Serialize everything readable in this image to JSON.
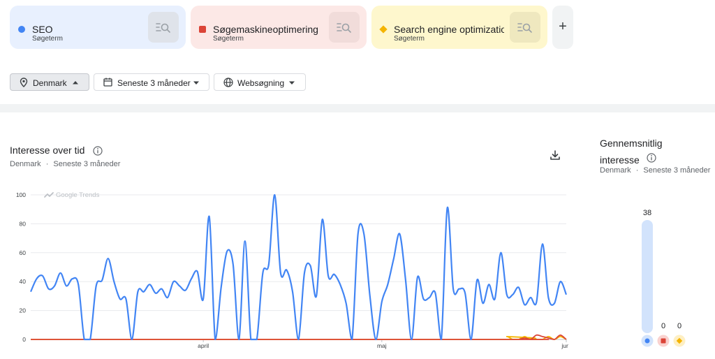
{
  "terms": [
    {
      "name": "SEO",
      "type": "Søgeterm",
      "color": "#4285f4"
    },
    {
      "name": "Søgemaskineoptimering",
      "type": "Søgeterm",
      "color": "#db4437"
    },
    {
      "name": "Search engine optimization",
      "type": "Søgeterm",
      "color": "#f4b400"
    }
  ],
  "add_label": "+",
  "filters": {
    "region": "Denmark",
    "period": "Seneste 3 måneder",
    "search_type": "Websøgning"
  },
  "interest_over_time": {
    "title": "Interesse over tid",
    "subtitle_region": "Denmark",
    "subtitle_sep": "·",
    "subtitle_period": "Seneste 3 måneder",
    "watermark": "Google Trends"
  },
  "average_interest": {
    "title_line1": "Gennemsnitlig",
    "title_line2": "interesse",
    "subtitle_region": "Denmark",
    "subtitle_sep": "·",
    "subtitle_period": "Seneste 3 måneder"
  },
  "chart_data": [
    {
      "type": "line",
      "title": "Interesse over tid",
      "y_ticks": [
        0,
        20,
        40,
        60,
        80,
        100
      ],
      "ylim": [
        0,
        100
      ],
      "x_tick_labels": [
        "april",
        "maj",
        "juni"
      ],
      "x_range": [
        "2024-03-03",
        "2024-06-01"
      ],
      "grid": true,
      "series": [
        {
          "name": "SEO",
          "color": "#4285f4",
          "x": [
            "2024-03-03",
            "2024-03-04",
            "2024-03-05",
            "2024-03-06",
            "2024-03-07",
            "2024-03-08",
            "2024-03-09",
            "2024-03-10",
            "2024-03-11",
            "2024-03-12",
            "2024-03-13",
            "2024-03-14",
            "2024-03-15",
            "2024-03-16",
            "2024-03-17",
            "2024-03-18",
            "2024-03-19",
            "2024-03-20",
            "2024-03-21",
            "2024-03-22",
            "2024-03-23",
            "2024-03-24",
            "2024-03-25",
            "2024-03-26",
            "2024-03-27",
            "2024-03-28",
            "2024-03-29",
            "2024-03-30",
            "2024-03-31",
            "2024-04-01",
            "2024-04-02",
            "2024-04-03",
            "2024-04-04",
            "2024-04-05",
            "2024-04-06",
            "2024-04-07",
            "2024-04-08",
            "2024-04-09",
            "2024-04-10",
            "2024-04-11",
            "2024-04-12",
            "2024-04-13",
            "2024-04-14",
            "2024-04-15",
            "2024-04-16",
            "2024-04-17",
            "2024-04-18",
            "2024-04-19",
            "2024-04-20",
            "2024-04-21",
            "2024-04-22",
            "2024-04-23",
            "2024-04-24",
            "2024-04-25",
            "2024-04-26",
            "2024-04-27",
            "2024-04-28",
            "2024-04-29",
            "2024-04-30",
            "2024-05-01",
            "2024-05-02",
            "2024-05-03",
            "2024-05-04",
            "2024-05-05",
            "2024-05-06",
            "2024-05-07",
            "2024-05-08",
            "2024-05-09",
            "2024-05-10",
            "2024-05-11",
            "2024-05-12",
            "2024-05-13",
            "2024-05-14",
            "2024-05-15",
            "2024-05-16",
            "2024-05-17",
            "2024-05-18",
            "2024-05-19",
            "2024-05-20",
            "2024-05-21",
            "2024-05-22",
            "2024-05-23",
            "2024-05-24",
            "2024-05-25",
            "2024-05-26",
            "2024-05-27",
            "2024-05-28",
            "2024-05-29",
            "2024-05-30",
            "2024-05-31",
            "2024-06-01"
          ],
          "values": [
            33,
            42,
            44,
            35,
            37,
            46,
            37,
            42,
            38,
            0,
            0,
            37,
            41,
            56,
            40,
            28,
            28,
            0,
            33,
            33,
            38,
            32,
            35,
            29,
            40,
            37,
            34,
            42,
            47,
            28,
            85,
            0,
            36,
            61,
            52,
            0,
            68,
            0,
            0,
            46,
            52,
            100,
            46,
            48,
            33,
            0,
            46,
            51,
            30,
            83,
            44,
            45,
            38,
            25,
            0,
            73,
            73,
            30,
            0,
            26,
            38,
            56,
            73,
            41,
            0,
            43,
            28,
            29,
            32,
            0,
            91,
            35,
            35,
            32,
            0,
            41,
            25,
            38,
            28,
            60,
            31,
            31,
            36,
            24,
            29,
            26,
            66,
            29,
            25,
            40,
            31
          ]
        },
        {
          "name": "Søgemaskineoptimering",
          "color": "#db4437",
          "x": [
            "2024-03-03",
            "2024-05-23",
            "2024-05-24",
            "2024-05-25",
            "2024-05-26",
            "2024-05-27",
            "2024-05-28",
            "2024-05-29",
            "2024-05-30",
            "2024-05-31",
            "2024-06-01"
          ],
          "values": [
            0,
            0,
            0,
            1,
            0,
            3,
            2,
            1,
            0,
            3,
            0
          ]
        },
        {
          "name": "Search engine optimization",
          "color": "#f4b400",
          "x": [
            "2024-03-03",
            "2024-05-21",
            "2024-05-22",
            "2024-05-23",
            "2024-05-24",
            "2024-05-25",
            "2024-05-26",
            "2024-05-27",
            "2024-05-28",
            "2024-05-29",
            "2024-05-30",
            "2024-05-31",
            "2024-06-01"
          ],
          "values": [
            0,
            0,
            2,
            0,
            0,
            2,
            0,
            0,
            0,
            2,
            0,
            2,
            0
          ]
        }
      ]
    },
    {
      "type": "bar",
      "title": "Gennemsnitlig interesse",
      "categories": [
        "SEO",
        "Søgemaskineoptimering",
        "Search engine optimization"
      ],
      "values": [
        38,
        0,
        0
      ],
      "colors": [
        "#4285f4",
        "#db4437",
        "#f4b400"
      ],
      "ylim": [
        0,
        100
      ]
    }
  ]
}
